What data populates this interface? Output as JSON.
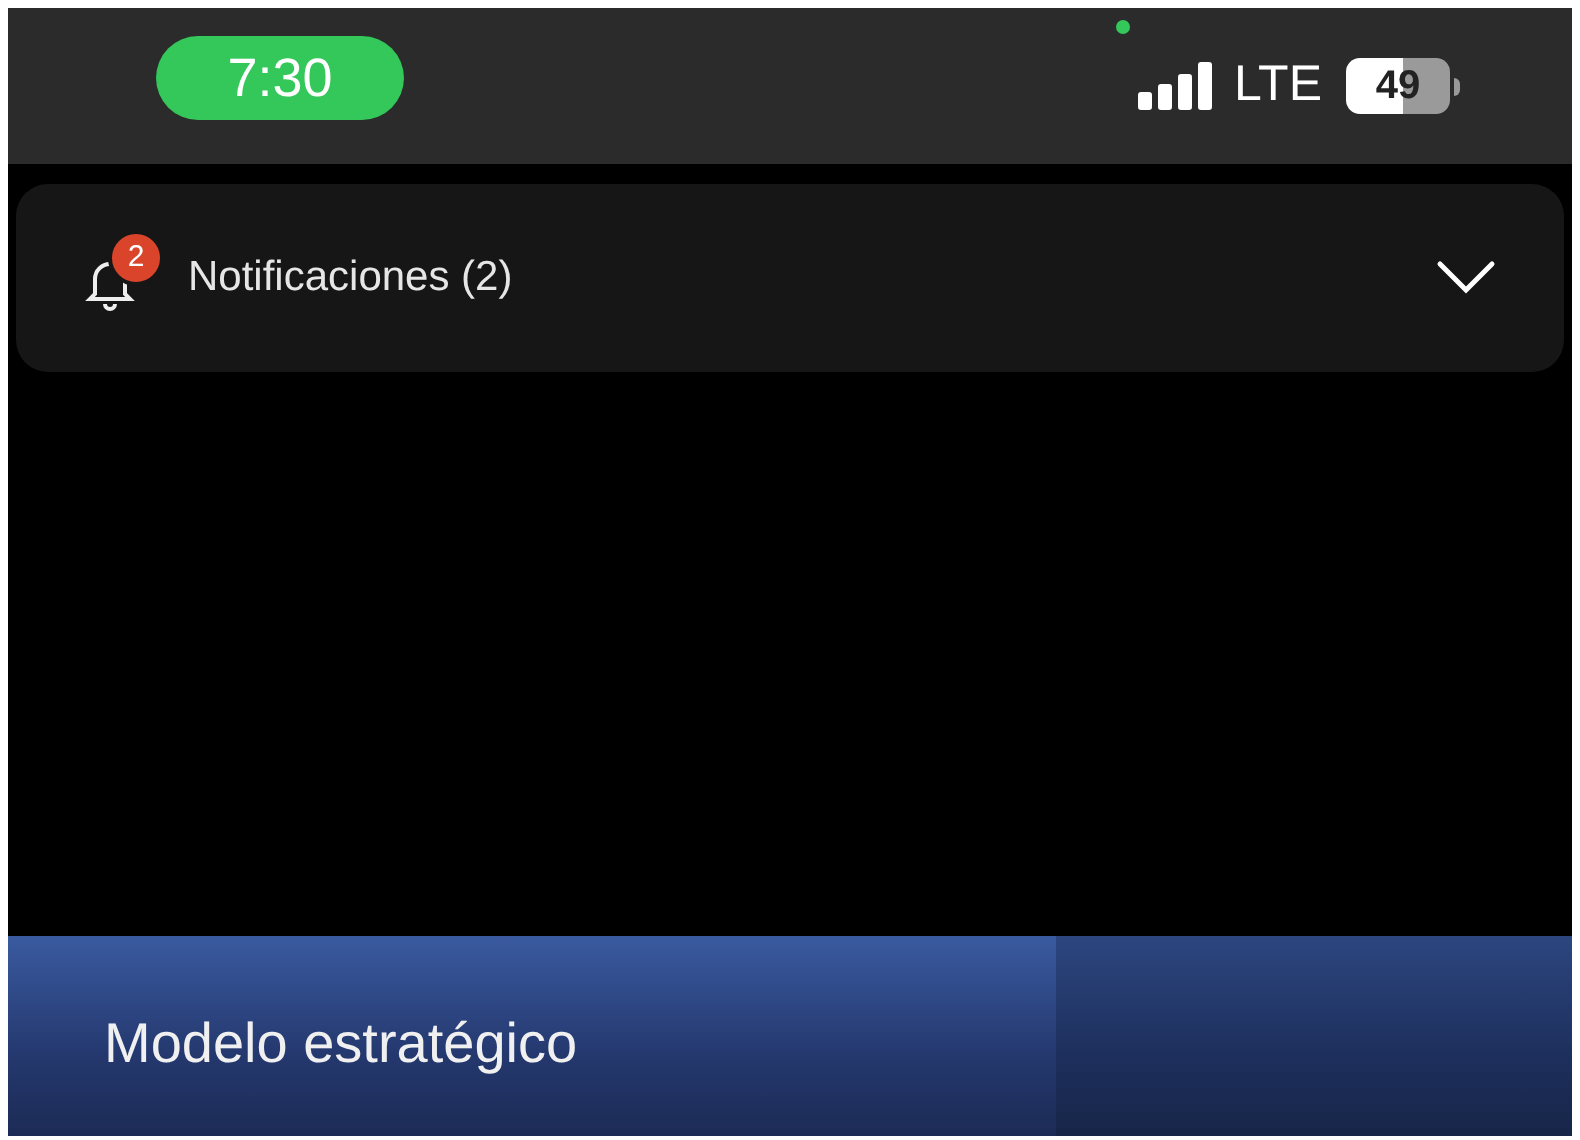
{
  "status_bar": {
    "time": "7:30",
    "network": "LTE",
    "battery": "49"
  },
  "notifications": {
    "label": "Notificaciones (2)",
    "badge": "2",
    "expanded": false
  },
  "slide": {
    "title": "Modelo estratégico"
  }
}
